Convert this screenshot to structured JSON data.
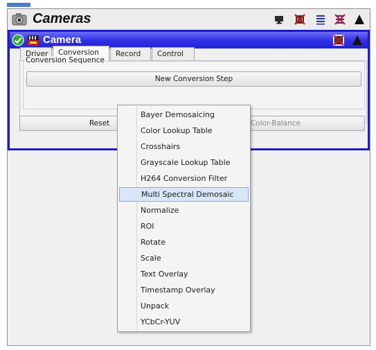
{
  "window": {
    "title": "Cameras",
    "icons": [
      "camera-app-icon",
      "monitor-icon",
      "no-video-icon",
      "list-icon",
      "close-x-icon",
      "collapse-up-icon"
    ]
  },
  "panel": {
    "title": "Camera",
    "status_icon": "check-circle-icon",
    "camera_icon": "live-camera-icon",
    "header_icons": [
      "no-video-icon",
      "collapse-up-icon"
    ]
  },
  "tabs": [
    {
      "label": "Driver",
      "active": false
    },
    {
      "label": "Conversion",
      "active": true
    },
    {
      "label": "Record",
      "active": false
    },
    {
      "label": "Control",
      "active": false
    }
  ],
  "group": {
    "label": "Conversion Sequence",
    "new_step_label": "New Conversion Step"
  },
  "buttons": {
    "reset_label": "Reset",
    "color_balance_label": "Color-Balance"
  },
  "menu": {
    "hover_index": 5,
    "items": [
      "Bayer Demosaicing",
      "Color Lookup Table",
      "Crosshairs",
      "Grayscale Lookup Table",
      "H264 Conversion Filter",
      "Multi Spectral Demosaic",
      "Normalize",
      "ROI",
      "Rotate",
      "Scale",
      "Text Overlay",
      "Timestamp Overlay",
      "Unpack",
      "YCbCr-YUV"
    ]
  },
  "colors": {
    "panel_border": "#1b1bc8",
    "panel_header": "#3232e6",
    "menu_hover": "#d8e6f8"
  }
}
